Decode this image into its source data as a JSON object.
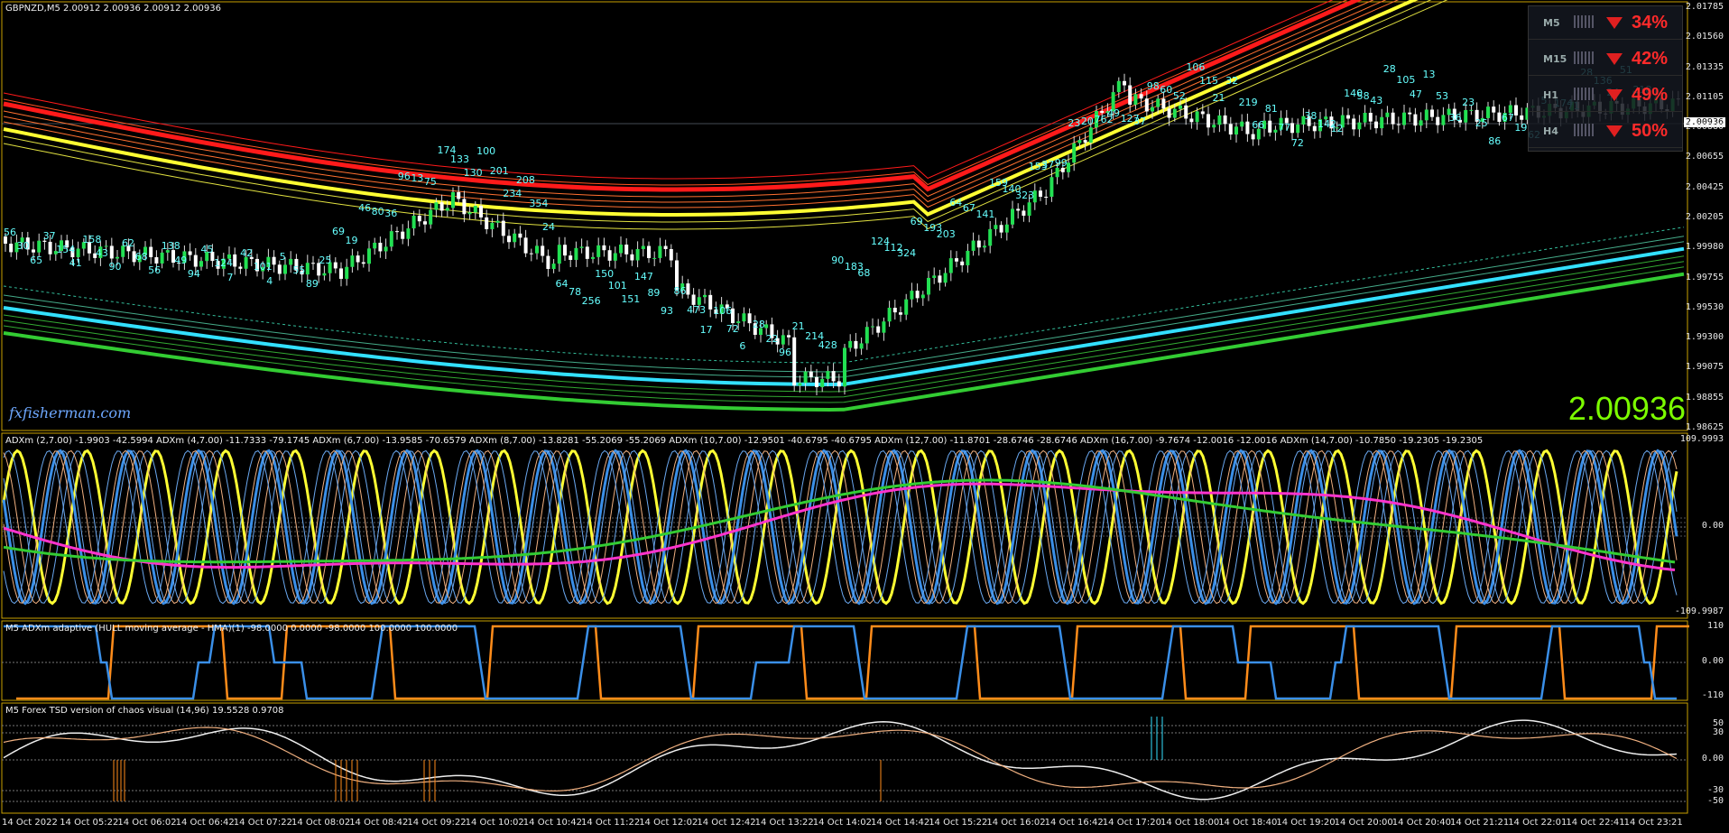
{
  "main": {
    "symbol_line": "GBPNZD,M5  2.00912 2.00936 2.00912 2.00936",
    "brand": "fxfisherman.com",
    "big_price": "2.00936",
    "current_price_tag": "2.00936",
    "price_axis": [
      "2.01785",
      "2.01560",
      "2.01335",
      "2.01105",
      "2.00880",
      "2.00655",
      "2.00425",
      "2.00205",
      "1.99980",
      "1.99755",
      "1.99530",
      "1.99300",
      "1.99075",
      "1.98855",
      "1.98625"
    ],
    "bar_labels": [
      "56",
      "30",
      "65",
      "37",
      "154",
      "41",
      "158",
      "43",
      "90",
      "62",
      "68",
      "56",
      "138",
      "49",
      "94",
      "45",
      "124",
      "7",
      "42",
      "101",
      "4",
      "5",
      "55",
      "89",
      "25",
      "69",
      "19",
      "46",
      "80",
      "36",
      "96",
      "13",
      "75",
      "174",
      "133",
      "130",
      "100",
      "201",
      "234",
      "208",
      "354",
      "24",
      "64",
      "78",
      "256",
      "150",
      "101",
      "151",
      "147",
      "89",
      "93",
      "86",
      "473",
      "17",
      "106",
      "72",
      "6",
      "28",
      "22",
      "96",
      "21",
      "214",
      "428",
      "90",
      "183",
      "68",
      "124",
      "112",
      "324",
      "69",
      "193",
      "203",
      "64",
      "67",
      "141",
      "159",
      "140",
      "323",
      "153",
      "37",
      "99",
      "23",
      "20",
      "762",
      "49",
      "127",
      "37",
      "98",
      "60",
      "52",
      "106",
      "115",
      "21",
      "32",
      "219",
      "66",
      "81",
      "77",
      "72",
      "38",
      "142",
      "12",
      "140",
      "58",
      "43",
      "28",
      "105",
      "47",
      "13",
      "53",
      "36",
      "23",
      "25",
      "86",
      "67",
      "19",
      "62",
      "5",
      "174",
      "71",
      "28",
      "136",
      "24",
      "51",
      "218"
    ],
    "mtf_panel": [
      {
        "tf": "M5",
        "pct": "34%"
      },
      {
        "tf": "M15",
        "pct": "42%"
      },
      {
        "tf": "H1",
        "pct": "49%"
      },
      {
        "tf": "H4",
        "pct": "50%"
      }
    ]
  },
  "adx_panel": {
    "title": "ADXm (2,7.00) -1.9903 -42.5994  ADXm (4,7.00) -11.7333 -79.1745  ADXm (6,7.00) -13.9585 -70.6579  ADXm (8,7.00) -13.8281 -55.2069 -55.2069  ADXm (10,7.00) -12.9501 -40.6795 -40.6795  ADXm (12,7.00) -11.8701 -28.6746 -28.6746  ADXm (16,7.00) -9.7674 -12.0016 -12.0016  ADXm (14,7.00) -10.7850 -19.2305 -19.2305",
    "axis": [
      "109.9993",
      "0.00",
      "-109.9987"
    ]
  },
  "hma_panel": {
    "title": "M5 ADXm adaptive (HULL moving average - HMA)(1) -98.0000 0.0000 -98.0000 100.0000 100.0000",
    "axis": [
      "110",
      "0.00",
      "-110"
    ]
  },
  "tsd_panel": {
    "title": "M5 Forex TSD version of chaos visual (14,96) 19.5528 0.9708",
    "axis": [
      "50",
      "30",
      "0.00",
      "-30",
      "-50"
    ]
  },
  "time_axis": [
    "14 Oct 2022",
    "14 Oct 05:22",
    "14 Oct 06:02",
    "14 Oct 06:42",
    "14 Oct 07:22",
    "14 Oct 08:02",
    "14 Oct 08:42",
    "14 Oct 09:22",
    "14 Oct 10:02",
    "14 Oct 10:42",
    "14 Oct 11:22",
    "14 Oct 12:02",
    "14 Oct 12:42",
    "14 Oct 13:22",
    "14 Oct 14:02",
    "14 Oct 14:42",
    "14 Oct 15:22",
    "14 Oct 16:02",
    "14 Oct 16:42",
    "14 Oct 17:20",
    "14 Oct 18:00",
    "14 Oct 18:40",
    "14 Oct 19:20",
    "14 Oct 20:00",
    "14 Oct 20:40",
    "14 Oct 21:21",
    "14 Oct 22:01",
    "14 Oct 22:41",
    "14 Oct 23:21"
  ],
  "colors": {
    "yellow": "#ffff33",
    "red": "#ff1a1a",
    "cyan": "#33e0ff",
    "green": "#33cc33",
    "blue": "#3a8fe8",
    "orange": "#ff8c1a",
    "magenta": "#ff33cc",
    "peach": "#f0b080"
  }
}
